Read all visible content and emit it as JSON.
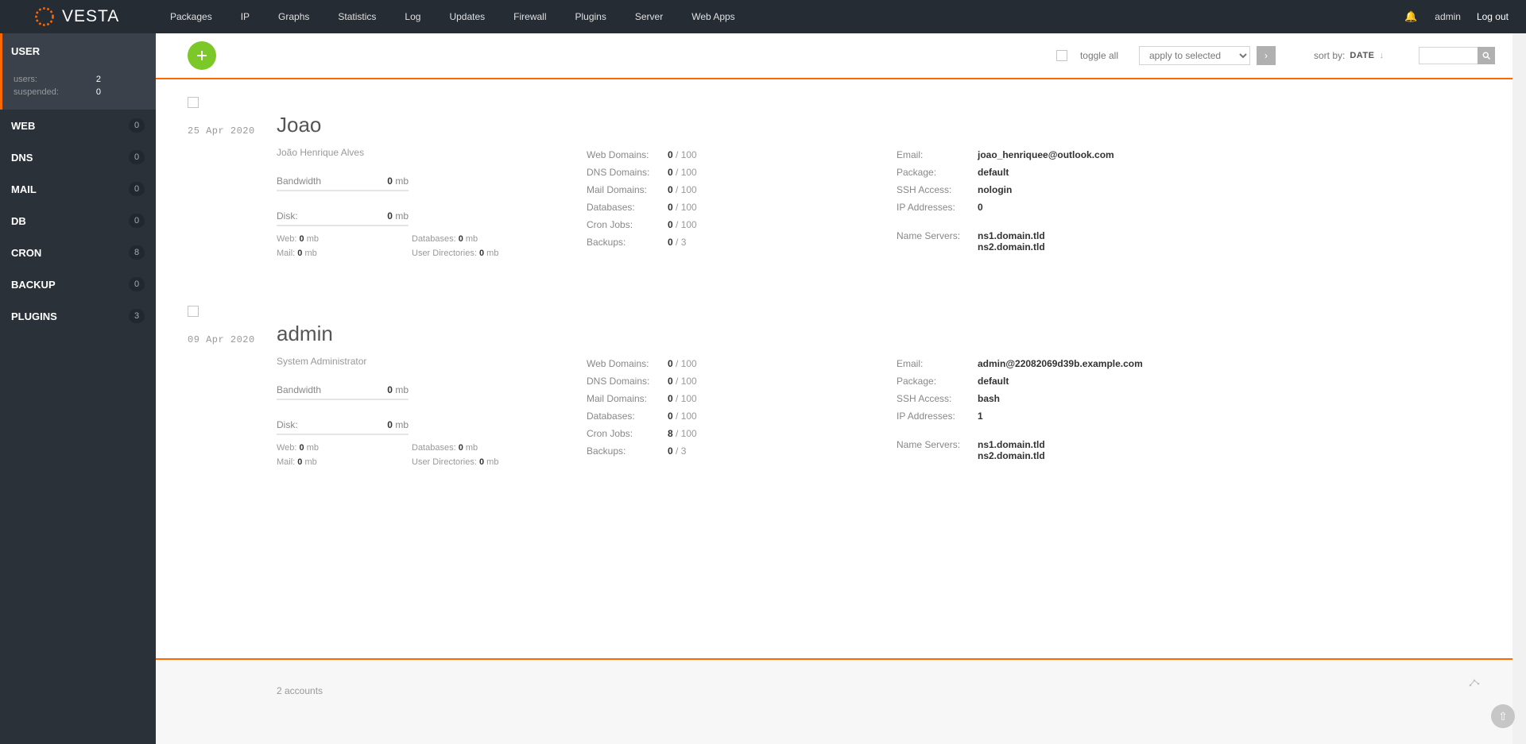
{
  "brand": "VESTA",
  "topnav": {
    "items": [
      "Packages",
      "IP",
      "Graphs",
      "Statistics",
      "Log",
      "Updates",
      "Firewall",
      "Plugins",
      "Server",
      "Web Apps"
    ],
    "user": "admin",
    "logout": "Log out"
  },
  "sidebar": {
    "active": {
      "label": "USER",
      "sub": [
        {
          "k": "users:",
          "v": "2"
        },
        {
          "k": "suspended:",
          "v": "0"
        }
      ]
    },
    "items": [
      {
        "label": "WEB",
        "badge": "0"
      },
      {
        "label": "DNS",
        "badge": "0"
      },
      {
        "label": "MAIL",
        "badge": "0"
      },
      {
        "label": "DB",
        "badge": "0"
      },
      {
        "label": "CRON",
        "badge": "8"
      },
      {
        "label": "BACKUP",
        "badge": "0"
      },
      {
        "label": "PLUGINS",
        "badge": "3"
      }
    ]
  },
  "toolbar": {
    "toggle_all": "toggle all",
    "apply_placeholder": "apply to selected",
    "sort_label": "sort by:",
    "sort_value": "DATE"
  },
  "users": [
    {
      "date": "25 Apr 2020",
      "name": "Joao",
      "fullname": "João Henrique Alves",
      "bandwidth": {
        "used": "0",
        "unit": "mb"
      },
      "disk": {
        "used": "0",
        "unit": "mb"
      },
      "disk_detail": {
        "web": "0",
        "databases": "0",
        "mail": "0",
        "user_dirs": "0"
      },
      "stats": {
        "web_domains": {
          "v": "0",
          "max": "100"
        },
        "dns_domains": {
          "v": "0",
          "max": "100"
        },
        "mail_domains": {
          "v": "0",
          "max": "100"
        },
        "databases": {
          "v": "0",
          "max": "100"
        },
        "cron_jobs": {
          "v": "0",
          "max": "100"
        },
        "backups": {
          "v": "0",
          "max": "3"
        }
      },
      "details": {
        "email": "joao_henriquee@outlook.com",
        "package": "default",
        "ssh": "nologin",
        "ips": "0",
        "ns": [
          "ns1.domain.tld",
          "ns2.domain.tld"
        ]
      }
    },
    {
      "date": "09 Apr 2020",
      "name": "admin",
      "fullname": "System Administrator",
      "bandwidth": {
        "used": "0",
        "unit": "mb"
      },
      "disk": {
        "used": "0",
        "unit": "mb"
      },
      "disk_detail": {
        "web": "0",
        "databases": "0",
        "mail": "0",
        "user_dirs": "0"
      },
      "stats": {
        "web_domains": {
          "v": "0",
          "max": "100"
        },
        "dns_domains": {
          "v": "0",
          "max": "100"
        },
        "mail_domains": {
          "v": "0",
          "max": "100"
        },
        "databases": {
          "v": "0",
          "max": "100"
        },
        "cron_jobs": {
          "v": "8",
          "max": "100"
        },
        "backups": {
          "v": "0",
          "max": "3"
        }
      },
      "details": {
        "email": "admin@22082069d39b.example.com",
        "package": "default",
        "ssh": "bash",
        "ips": "1",
        "ns": [
          "ns1.domain.tld",
          "ns2.domain.tld"
        ]
      }
    }
  ],
  "labels": {
    "bandwidth": "Bandwidth",
    "disk": "Disk:",
    "web": "Web:",
    "databases_disk": "Databases:",
    "mail": "Mail:",
    "user_dirs": "User Directories:",
    "mb": "mb",
    "web_domains": "Web Domains:",
    "dns_domains": "DNS Domains:",
    "mail_domains": "Mail Domains:",
    "databases": "Databases:",
    "cron_jobs": "Cron Jobs:",
    "backups": "Backups:",
    "email": "Email:",
    "package": "Package:",
    "ssh": "SSH Access:",
    "ips": "IP Addresses:",
    "ns": "Name Servers:"
  },
  "footer": {
    "accounts": "2 accounts"
  }
}
